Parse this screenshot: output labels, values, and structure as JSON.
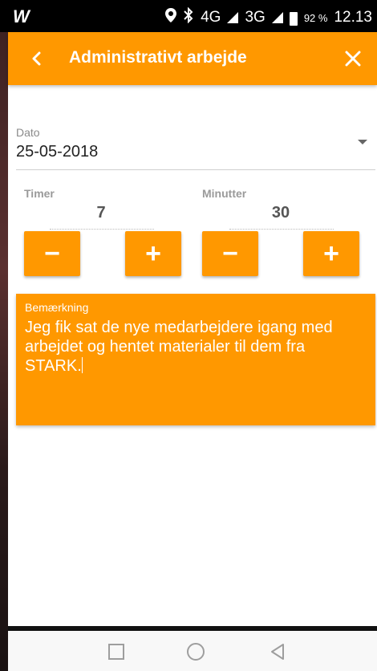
{
  "status_bar": {
    "logo": "W",
    "network_primary": "4G",
    "network_secondary": "3G",
    "battery": "92 %",
    "time": "12.13"
  },
  "app_bar": {
    "title": "Administrativt arbejde"
  },
  "form": {
    "date_label": "Dato",
    "date_value": "25-05-2018",
    "hours_label": "Timer",
    "hours_value": "7",
    "minutes_label": "Minutter",
    "minutes_value": "30",
    "minus_symbol": "−",
    "plus_symbol": "+"
  },
  "note": {
    "label": "Bemærkning",
    "text": "Jeg fik sat de nye medarbejdere igang med arbejdet og hentet materialer til dem fra STARK."
  },
  "colors": {
    "accent": "#ff9800",
    "background": "#ffffff"
  },
  "icons": [
    "back-icon",
    "close-icon",
    "dropdown-arrow-icon",
    "recent-apps-icon",
    "home-icon",
    "back-nav-icon"
  ]
}
